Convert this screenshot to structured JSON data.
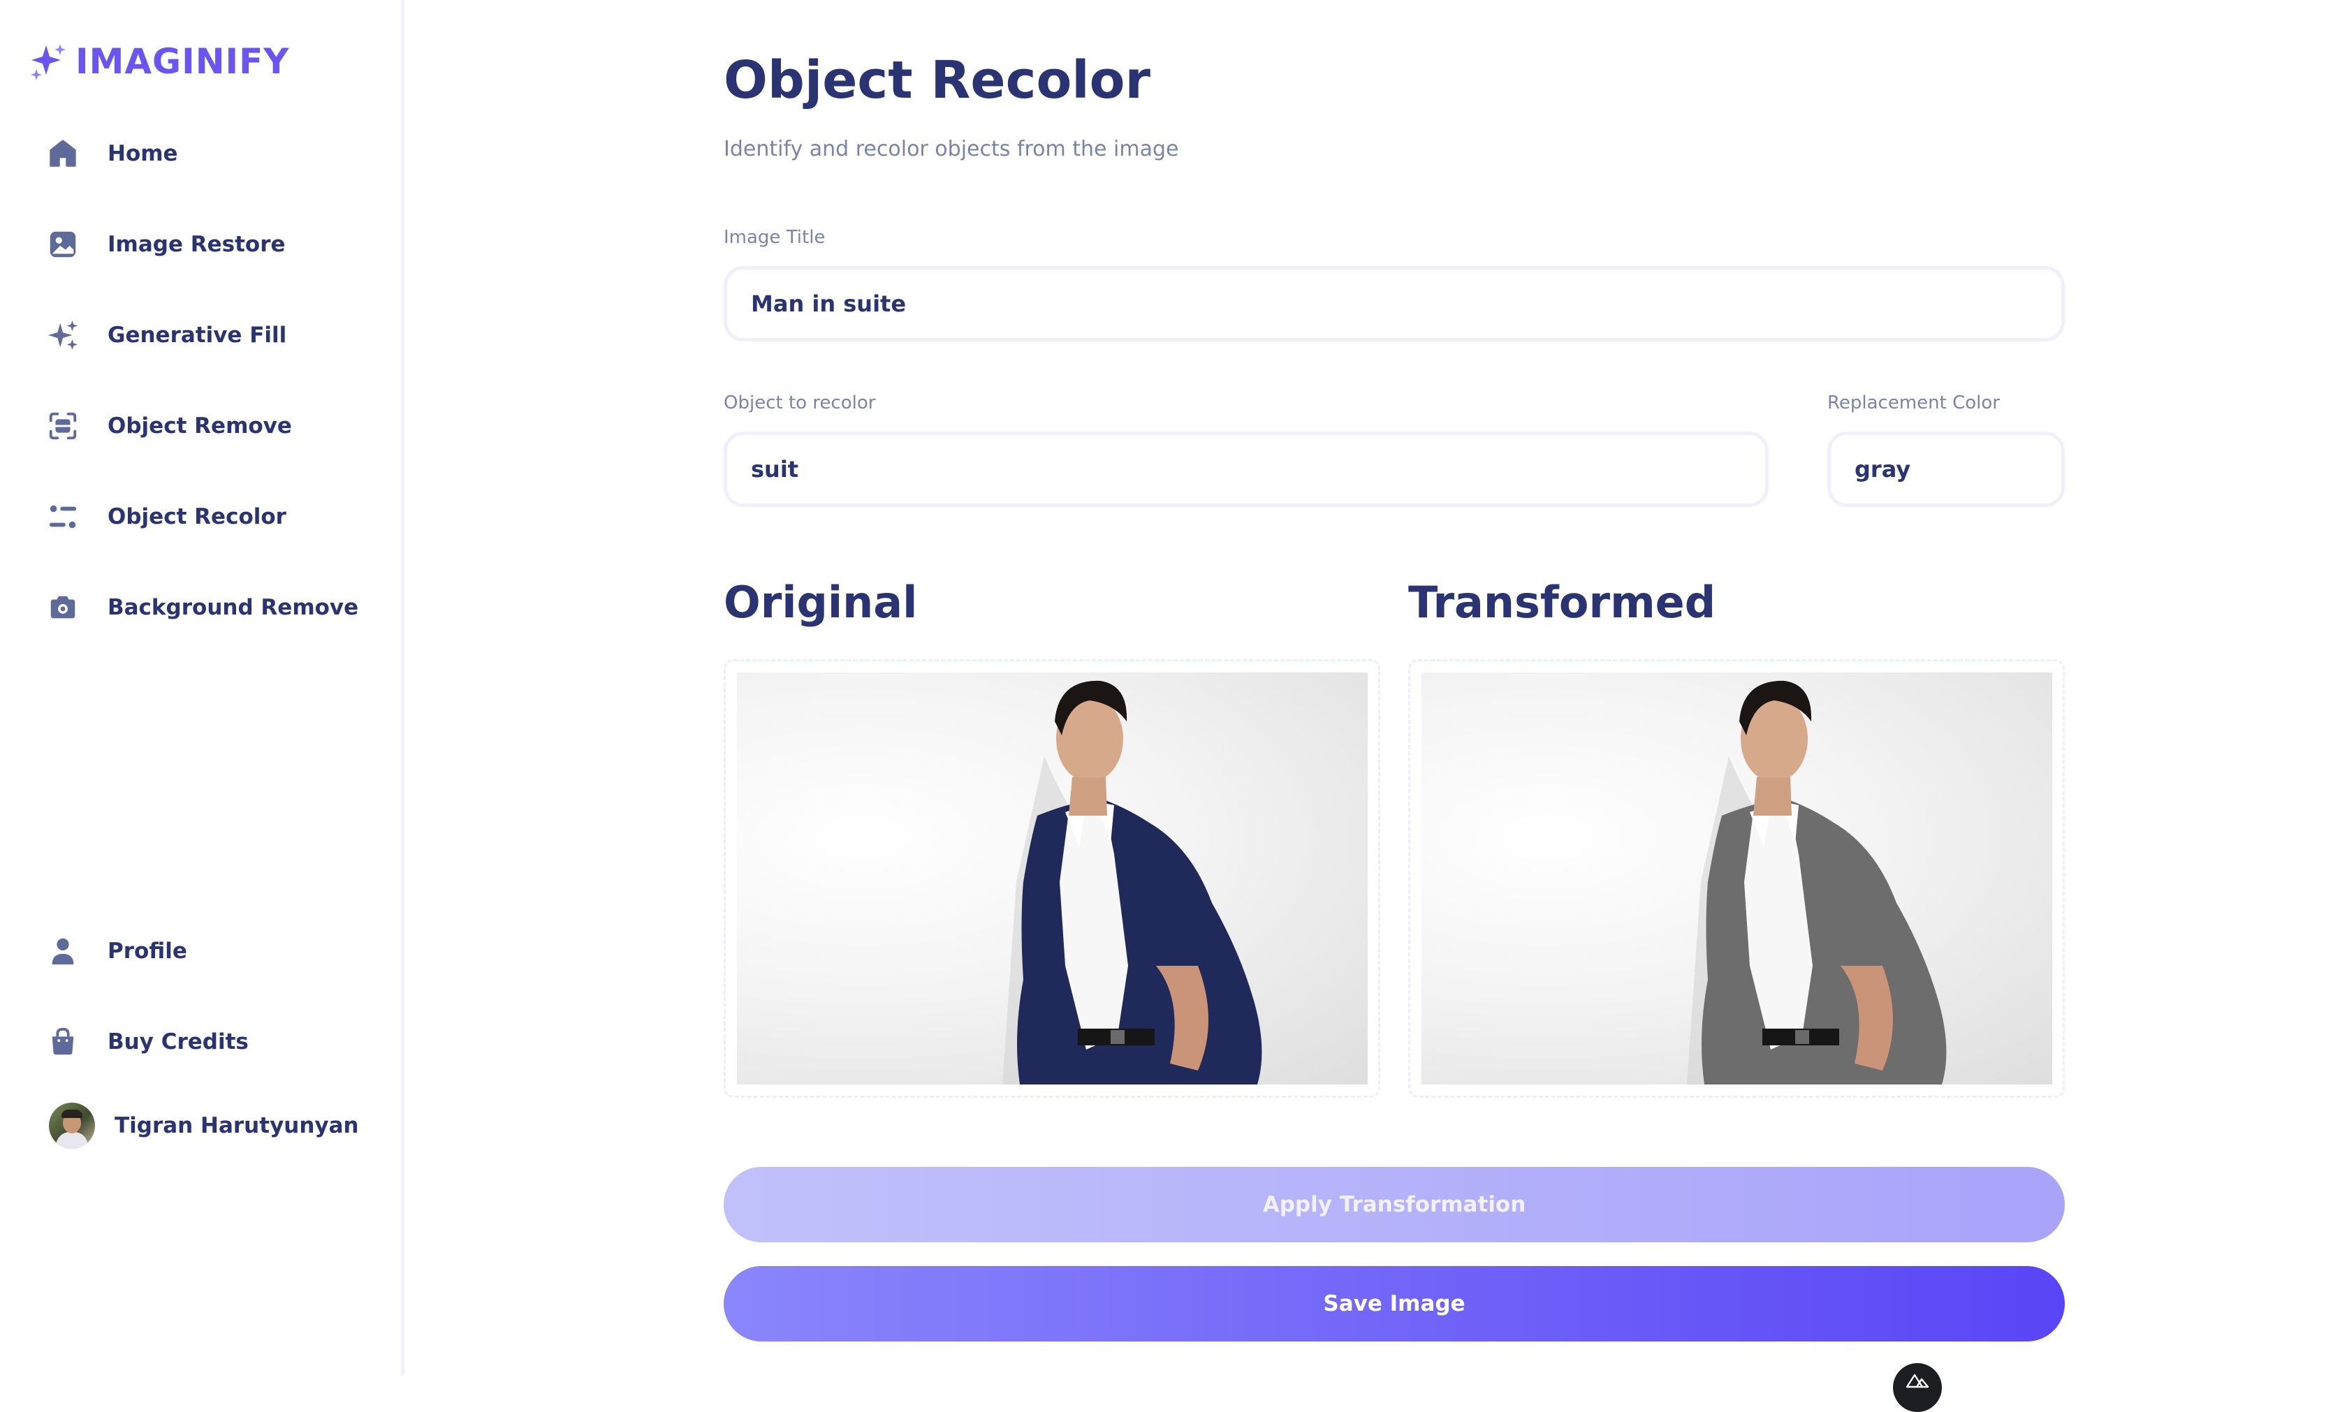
{
  "app": {
    "logo_text": "IMAGINIFY",
    "accent_color": "#6b55f0"
  },
  "sidebar": {
    "items": [
      {
        "label": "Home",
        "icon": "home-icon"
      },
      {
        "label": "Image Restore",
        "icon": "image-icon"
      },
      {
        "label": "Generative Fill",
        "icon": "stars-icon"
      },
      {
        "label": "Object Remove",
        "icon": "scan-icon"
      },
      {
        "label": "Object Recolor",
        "icon": "filter-icon"
      },
      {
        "label": "Background Remove",
        "icon": "camera-icon"
      }
    ],
    "bottom_items": [
      {
        "label": "Profile",
        "icon": "user-icon"
      },
      {
        "label": "Buy Credits",
        "icon": "bag-icon"
      }
    ],
    "user": {
      "name": "Tigran Harutyunyan",
      "avatar": "avatar-photo"
    }
  },
  "main": {
    "title": "Object Recolor",
    "subtitle": "Identify and recolor objects from the image",
    "form": {
      "image_title": {
        "label": "Image Title",
        "value": "Man in suite"
      },
      "object": {
        "label": "Object to recolor",
        "value": "suit"
      },
      "color": {
        "label": "Replacement Color",
        "value": "gray"
      }
    },
    "original_label": "Original",
    "transformed_label": "Transformed",
    "original_suit_color": "#1f2a5a",
    "transformed_suit_color": "#6d6d6d",
    "apply_button": "Apply Transformation",
    "save_button": "Save Image"
  }
}
